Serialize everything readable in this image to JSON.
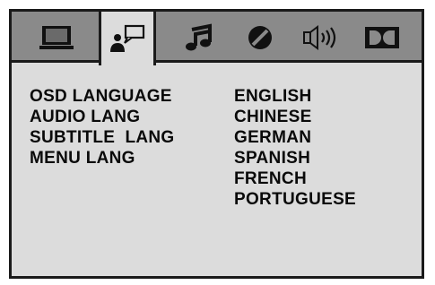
{
  "tabs": [
    {
      "icon": "monitor-icon",
      "active": false
    },
    {
      "icon": "person-speech-icon",
      "active": true
    },
    {
      "icon": "music-note-icon",
      "active": false
    },
    {
      "icon": "disc-icon",
      "active": false
    },
    {
      "icon": "speaker-icon",
      "active": false
    },
    {
      "icon": "dolby-icon",
      "active": false
    }
  ],
  "menu": {
    "items": [
      "OSD LANGUAGE",
      "AUDIO LANG",
      "SUBTITLE  LANG",
      "MENU LANG"
    ]
  },
  "options": {
    "items": [
      "ENGLISH",
      "CHINESE",
      "GERMAN",
      "SPANISH",
      "FRENCH",
      "PORTUGUESE"
    ]
  },
  "colors": {
    "tabbar": "#8a8a8a",
    "panel": "#dcdcdc",
    "border": "#1a1a1a",
    "text": "#0a0a0a"
  }
}
